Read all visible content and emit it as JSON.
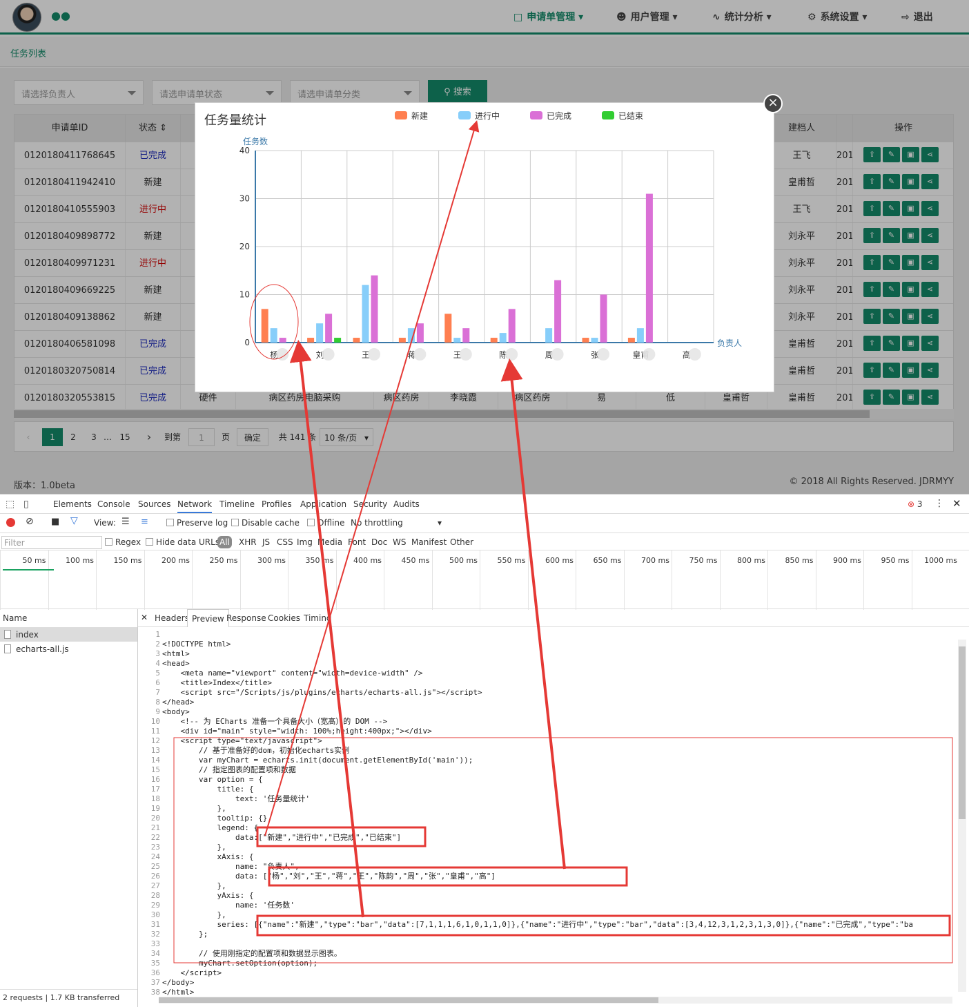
{
  "nav": {
    "items": [
      {
        "label": "申请单管理",
        "icon": "file-icon",
        "active": true
      },
      {
        "label": "用户管理",
        "icon": "users-icon",
        "active": false
      },
      {
        "label": "统计分析",
        "icon": "pulse-icon",
        "active": false
      },
      {
        "label": "系统设置",
        "icon": "gear-icon",
        "active": false
      },
      {
        "label": "退出",
        "icon": "logout-icon",
        "active": false
      }
    ]
  },
  "subbar": {
    "title": "任务列表"
  },
  "filters": {
    "owner_placeholder": "请选择负责人",
    "status_placeholder": "请选申请单状态",
    "category_placeholder": "请选申请单分类",
    "search_label": "搜索"
  },
  "table": {
    "headers": [
      "申请单ID",
      "状态",
      "建档人",
      "操作"
    ],
    "rows": [
      {
        "id": "0120180411768645",
        "status": "已完成",
        "creator": "王飞",
        "date": "201"
      },
      {
        "id": "0120180411942410",
        "status": "新建",
        "creator": "皇甫哲",
        "date": "201"
      },
      {
        "id": "0120180410555903",
        "status": "进行中",
        "creator": "王飞",
        "date": "201"
      },
      {
        "id": "0120180409898772",
        "status": "新建",
        "creator": "刘永平",
        "date": "201"
      },
      {
        "id": "0120180409971231",
        "status": "进行中",
        "creator": "刘永平",
        "date": "201"
      },
      {
        "id": "0120180409669225",
        "status": "新建",
        "creator": "刘永平",
        "date": "201"
      },
      {
        "id": "0120180409138862",
        "status": "新建",
        "creator": "刘永平",
        "date": "201"
      },
      {
        "id": "0120180406581098",
        "status": "已完成",
        "creator": "皇甫哲",
        "date": "201"
      },
      {
        "id": "0120180320750814",
        "status": "已完成",
        "creator": "皇甫哲",
        "date": "201"
      },
      {
        "id": "0120180320553815",
        "status": "已完成",
        "creator": "皇甫哲",
        "date": "201"
      }
    ],
    "last_row_extra": [
      "硬件",
      "病区药房电脑采购",
      "病区药房",
      "李晓霞",
      "病区药房",
      "易",
      "低",
      "皇甫哲"
    ]
  },
  "pager": {
    "pages": [
      "1",
      "2",
      "3",
      "…",
      "15"
    ],
    "goto_label": "到第",
    "page_value": "1",
    "page_unit": "页",
    "confirm": "确定",
    "total": "共 141 条",
    "page_size": "10 条/页"
  },
  "footer": {
    "version": "版本：1.0beta",
    "copyright": "© 2018 All Rights Reserved. JDRMYY"
  },
  "chart_data": {
    "type": "bar",
    "title": "任务量统计",
    "ylabel": "任务数",
    "xlabel": "负责人",
    "ylim": [
      0,
      40
    ],
    "yticks": [
      0,
      10,
      20,
      30,
      40
    ],
    "legend_position": "top-center",
    "categories": [
      "杨",
      "刘",
      "王",
      "蒋",
      "王",
      "陈",
      "周",
      "张",
      "皇甫",
      "高"
    ],
    "series": [
      {
        "name": "新建",
        "color": "#ff7f50",
        "values": [
          7,
          1,
          1,
          1,
          6,
          1,
          0,
          1,
          1,
          0
        ]
      },
      {
        "name": "进行中",
        "color": "#87cefa",
        "values": [
          3,
          4,
          12,
          3,
          1,
          2,
          3,
          1,
          3,
          0
        ]
      },
      {
        "name": "已完成",
        "color": "#da70d6",
        "values": [
          1,
          6,
          14,
          4,
          3,
          7,
          13,
          10,
          31,
          0
        ]
      },
      {
        "name": "已结束",
        "color": "#32cd32",
        "values": [
          0,
          1,
          0,
          0,
          0,
          0,
          0,
          0,
          0,
          0
        ]
      }
    ]
  },
  "devtools": {
    "tabs": [
      "Elements",
      "Console",
      "Sources",
      "Network",
      "Timeline",
      "Profiles",
      "Application",
      "Security",
      "Audits"
    ],
    "error_count": "3",
    "toolbar": {
      "view": "View:",
      "preserve_log": "Preserve log",
      "disable_cache": "Disable cache",
      "offline": "Offline",
      "throttling": "No throttling"
    },
    "filter_placeholder": "Filter",
    "filter_types": [
      "Regex",
      "Hide data URLs",
      "All",
      "XHR",
      "JS",
      "CSS",
      "Img",
      "Media",
      "Font",
      "Doc",
      "WS",
      "Manifest",
      "Other"
    ],
    "ticks": [
      "50 ms",
      "100 ms",
      "150 ms",
      "200 ms",
      "250 ms",
      "300 ms",
      "350 ms",
      "400 ms",
      "450 ms",
      "500 ms",
      "550 ms",
      "600 ms",
      "650 ms",
      "700 ms",
      "750 ms",
      "800 ms",
      "850 ms",
      "900 ms",
      "950 ms",
      "1000 ms"
    ],
    "name_header": "Name",
    "files": [
      "index",
      "echarts-all.js"
    ],
    "status": "2 requests  |  1.7 KB transferred",
    "detail_tabs": [
      "Headers",
      "Preview",
      "Response",
      "Cookies",
      "Timing"
    ],
    "code": [
      "",
      "<!DOCTYPE html>",
      "<html>",
      "<head>",
      "    <meta name=\"viewport\" content=\"width=device-width\" />",
      "    <title>Index</title>",
      "    <script src=\"/Scripts/js/plugins/echarts/echarts-all.js\"></script>",
      "</head>",
      "<body>",
      "    <!-- 为 ECharts 准备一个具备大小（宽高）的 DOM -->",
      "    <div id=\"main\" style=\"width: 100%;height:400px;\"></div>",
      "    <script type=\"text/javascript\">",
      "        // 基于准备好的dom，初始化echarts实例",
      "        var myChart = echarts.init(document.getElementById('main'));",
      "        // 指定图表的配置项和数据",
      "        var option = {",
      "            title: {",
      "                text: '任务量统计'",
      "            },",
      "            tooltip: {},",
      "            legend: {",
      "                data:[\"新建\",\"进行中\",\"已完成\",\"已结束\"]",
      "            },",
      "            xAxis: {",
      "                name: \"负责人\",",
      "                data: [\"杨\",\"刘\",\"王\",\"蒋\",\"王\",\"陈韵\",\"周\",\"张\",\"皇甫\",\"高\"]",
      "            },",
      "            yAxis: {",
      "                name: '任务数'",
      "            },",
      "            series: [{\"name\":\"新建\",\"type\":\"bar\",\"data\":[7,1,1,1,6,1,0,1,1,0]},{\"name\":\"进行中\",\"type\":\"bar\",\"data\":[3,4,12,3,1,2,3,1,3,0]},{\"name\":\"已完成\",\"type\":\"ba",
      "        };",
      "",
      "        // 使用刚指定的配置项和数据显示图表。",
      "        myChart.setOption(option);",
      "    </script>",
      "</body>",
      "</html>"
    ]
  }
}
